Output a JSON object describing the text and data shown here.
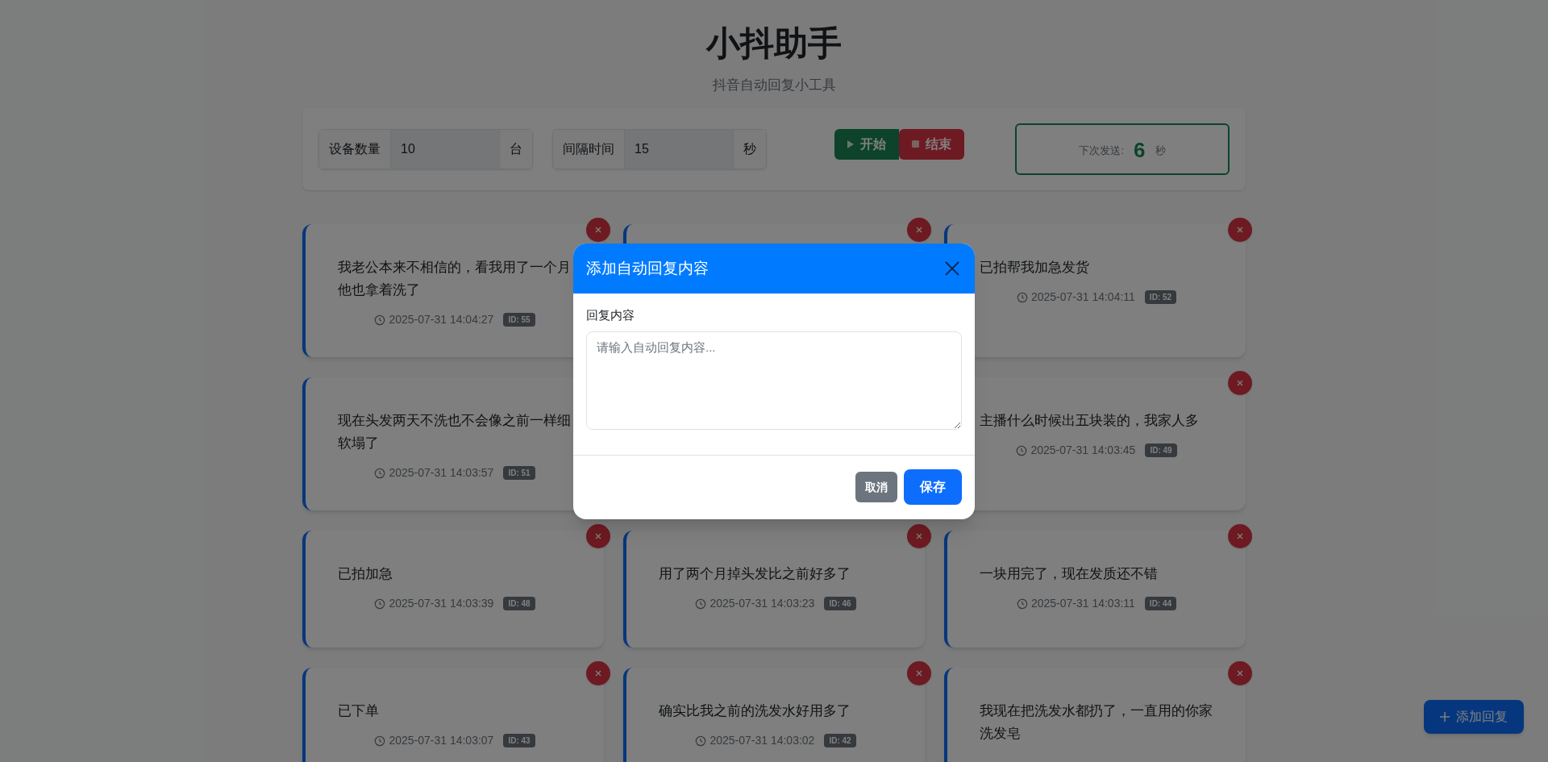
{
  "header": {
    "title": "小抖助手",
    "subtitle": "抖音自动回复小工具"
  },
  "controls": {
    "fields": [
      {
        "label": "设备数量",
        "value": "10",
        "unit": "台"
      },
      {
        "label": "间隔时间",
        "value": "15",
        "unit": "秒"
      }
    ],
    "buttons": [
      {
        "label": "开始",
        "kind": "start"
      },
      {
        "label": "结束",
        "kind": "stop"
      }
    ],
    "next_send": {
      "label": "下次发送:",
      "value": "6",
      "unit": "秒"
    }
  },
  "replies": [
    {
      "kind": "reply",
      "text": "我老公本来不相信的，看我用了一个月他也拿着洗了",
      "time": "2025-07-31 14:04:27",
      "id_badge": "ID: 55"
    },
    {
      "kind": "covered"
    },
    {
      "kind": "reply",
      "text": "已拍帮我加急发货",
      "time": "2025-07-31 14:04:11",
      "id_badge": "ID: 52"
    },
    {
      "kind": "reply",
      "text": "现在头发两天不洗也不会像之前一样细软塌了",
      "time": "2025-07-31 14:03:57",
      "id_badge": "ID: 51"
    },
    {
      "kind": "hidden"
    },
    {
      "kind": "reply",
      "text": "主播什么时候出五块装的，我家人多",
      "time": "2025-07-31 14:03:45",
      "id_badge": "ID: 49"
    },
    {
      "kind": "reply",
      "text": "已拍加急",
      "time": "2025-07-31 14:03:39",
      "id_badge": "ID: 48"
    },
    {
      "kind": "reply",
      "text": "用了两个月掉头发比之前好多了",
      "time": "2025-07-31 14:03:23",
      "id_badge": "ID: 46"
    },
    {
      "kind": "reply",
      "text": "一块用完了，现在发质还不错",
      "time": "2025-07-31 14:03:11",
      "id_badge": "ID: 44"
    },
    {
      "kind": "reply",
      "text": "已下单",
      "time": "2025-07-31 14:03:07",
      "id_badge": "ID: 43"
    },
    {
      "kind": "reply",
      "text": "确实比我之前的洗发水好用多了",
      "time": "2025-07-31 14:03:02",
      "id_badge": "ID: 42"
    },
    {
      "kind": "reply",
      "text": "我现在把洗发水都扔了，一直用的你家洗发皂"
    }
  ],
  "add_button": {
    "label": "添加回复"
  },
  "modal": {
    "title": "添加自动回复内容",
    "field_label": "回复内容",
    "placeholder": "请输入自动回复内容...",
    "buttons": [
      {
        "label": "取消",
        "kind": "secondary"
      },
      {
        "label": "保存",
        "kind": "primary"
      }
    ]
  }
}
